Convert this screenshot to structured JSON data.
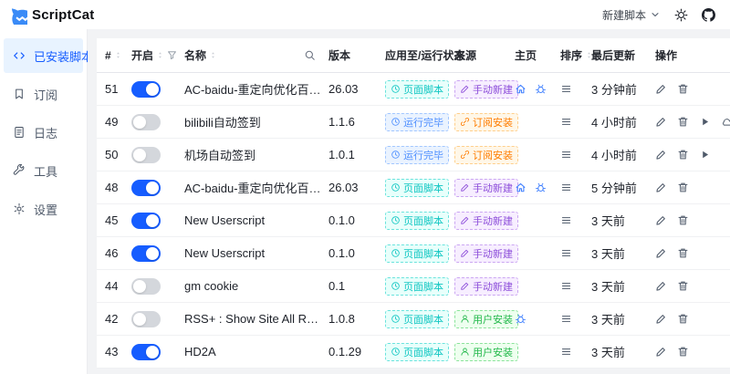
{
  "colors": {
    "primary": "#165DFF",
    "logo_blue": "#3A8BF7",
    "sidebar_active_bg": "#E8F3FF",
    "status_page": "#0FC6C2",
    "status_done": "#4E8FFF",
    "source_manual": "#8D4EDA",
    "source_subscribe": "#FF7D00",
    "source_user": "#23B84B"
  },
  "header": {
    "app_title": "ScriptCat",
    "new_script_label": "新建脚本",
    "icons": [
      "scriptcat-logo-icon",
      "chevron-down-icon",
      "theme-sun-icon",
      "github-icon"
    ]
  },
  "sidebar": {
    "items": [
      {
        "label": "已安装脚本",
        "icon": "code-icon",
        "slug": "sidebar-item-installed-scripts",
        "active": true
      },
      {
        "label": "订阅",
        "icon": "bookmark-icon",
        "slug": "sidebar-item-subscriptions",
        "active": false
      },
      {
        "label": "日志",
        "icon": "document-icon",
        "slug": "sidebar-item-logs",
        "active": false
      },
      {
        "label": "工具",
        "icon": "wrench-icon",
        "slug": "sidebar-item-tools",
        "active": false
      },
      {
        "label": "设置",
        "icon": "gear-icon",
        "slug": "sidebar-item-settings",
        "active": false
      }
    ]
  },
  "table": {
    "columns": {
      "id": "#",
      "enabled": "开启",
      "name": "名称",
      "version": "版本",
      "status": "应用至/运行状态",
      "source": "来源",
      "home": "主页",
      "sort": "排序",
      "updated": "最后更新",
      "actions": "操作"
    },
    "rows": [
      {
        "id": "51",
        "enabled": true,
        "name": "AC-baidu-重定向优化百度搜狗谷歌...",
        "version": "26.03",
        "status": "页面脚本",
        "status_type": "page",
        "source": "手动新建",
        "source_type": "manual",
        "home_icons": [
          "home",
          "bug"
        ],
        "updated": "3 分钟前",
        "actions": [
          "edit",
          "delete"
        ]
      },
      {
        "id": "49",
        "enabled": false,
        "name": "bilibili自动签到",
        "version": "1.1.6",
        "status": "运行完毕",
        "status_type": "done",
        "source": "订阅安装",
        "source_type": "subscribe",
        "home_icons": [],
        "updated": "4 小时前",
        "actions": [
          "edit",
          "delete",
          "run",
          "cloud"
        ]
      },
      {
        "id": "50",
        "enabled": false,
        "name": "机场自动签到",
        "version": "1.0.1",
        "status": "运行完毕",
        "status_type": "done",
        "source": "订阅安装",
        "source_type": "subscribe",
        "home_icons": [],
        "updated": "4 小时前",
        "actions": [
          "edit",
          "delete",
          "run"
        ]
      },
      {
        "id": "48",
        "enabled": true,
        "name": "AC-baidu-重定向优化百度搜狗谷歌...",
        "version": "26.03",
        "status": "页面脚本",
        "status_type": "page",
        "source": "手动新建",
        "source_type": "manual",
        "home_icons": [
          "home",
          "bug"
        ],
        "updated": "5 分钟前",
        "actions": [
          "edit",
          "delete"
        ]
      },
      {
        "id": "45",
        "enabled": true,
        "name": "New Userscript",
        "version": "0.1.0",
        "status": "页面脚本",
        "status_type": "page",
        "source": "手动新建",
        "source_type": "manual",
        "home_icons": [],
        "updated": "3 天前",
        "actions": [
          "edit",
          "delete"
        ]
      },
      {
        "id": "46",
        "enabled": true,
        "name": "New Userscript",
        "version": "0.1.0",
        "status": "页面脚本",
        "status_type": "page",
        "source": "手动新建",
        "source_type": "manual",
        "home_icons": [],
        "updated": "3 天前",
        "actions": [
          "edit",
          "delete"
        ]
      },
      {
        "id": "44",
        "enabled": false,
        "name": "gm cookie",
        "version": "0.1",
        "status": "页面脚本",
        "status_type": "page",
        "source": "手动新建",
        "source_type": "manual",
        "home_icons": [],
        "updated": "3 天前",
        "actions": [
          "edit",
          "delete"
        ]
      },
      {
        "id": "42",
        "enabled": false,
        "name": "RSS+ : Show Site All RSS",
        "version": "1.0.8",
        "status": "页面脚本",
        "status_type": "page",
        "source": "用户安装",
        "source_type": "user",
        "home_icons": [
          "bug"
        ],
        "updated": "3 天前",
        "actions": [
          "edit",
          "delete"
        ]
      },
      {
        "id": "43",
        "enabled": true,
        "name": "HD2A",
        "version": "0.1.29",
        "status": "页面脚本",
        "status_type": "page",
        "source": "用户安装",
        "source_type": "user",
        "home_icons": [],
        "updated": "3 天前",
        "actions": [
          "edit",
          "delete"
        ]
      }
    ]
  }
}
